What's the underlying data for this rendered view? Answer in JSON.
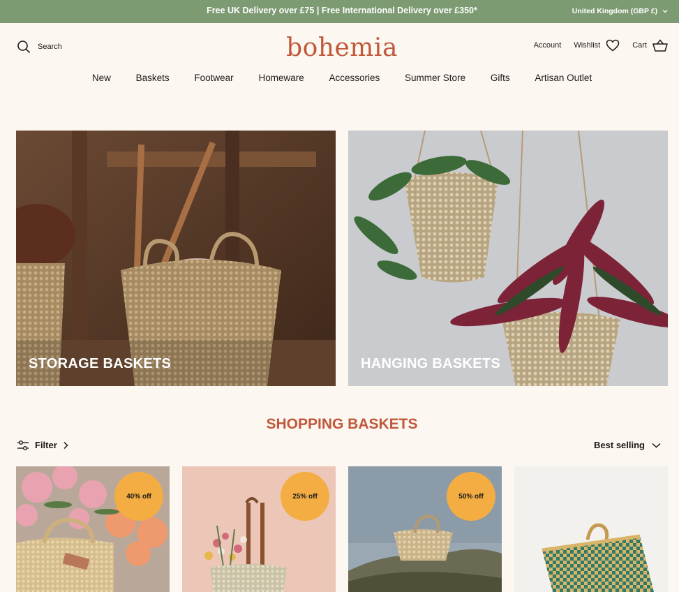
{
  "announcement": {
    "message": "Free UK Delivery over £75 | Free International Delivery over £350*",
    "country": "United Kingdom (GBP £)"
  },
  "header": {
    "search_label": "Search",
    "logo": "bohemia",
    "account_label": "Account",
    "wishlist_label": "Wishlist",
    "cart_label": "Cart"
  },
  "nav": {
    "items": [
      "New",
      "Baskets",
      "Footwear",
      "Homeware",
      "Accessories",
      "Summer Store",
      "Gifts",
      "Artisan Outlet"
    ]
  },
  "categories": [
    {
      "label": "STORAGE BASKETS"
    },
    {
      "label": "HANGING BASKETS"
    }
  ],
  "section": {
    "title": "SHOPPING BASKETS",
    "filter_label": "Filter",
    "sort_label": "Best selling"
  },
  "products": [
    {
      "badge": "40% off"
    },
    {
      "badge": "25% off"
    },
    {
      "badge": "50% off"
    },
    {
      "badge": ""
    }
  ],
  "colors": {
    "announcement_bg": "#7d9b72",
    "brand": "#c0583a",
    "page_bg": "#fcf7f0",
    "badge_bg": "#f3ad42"
  }
}
